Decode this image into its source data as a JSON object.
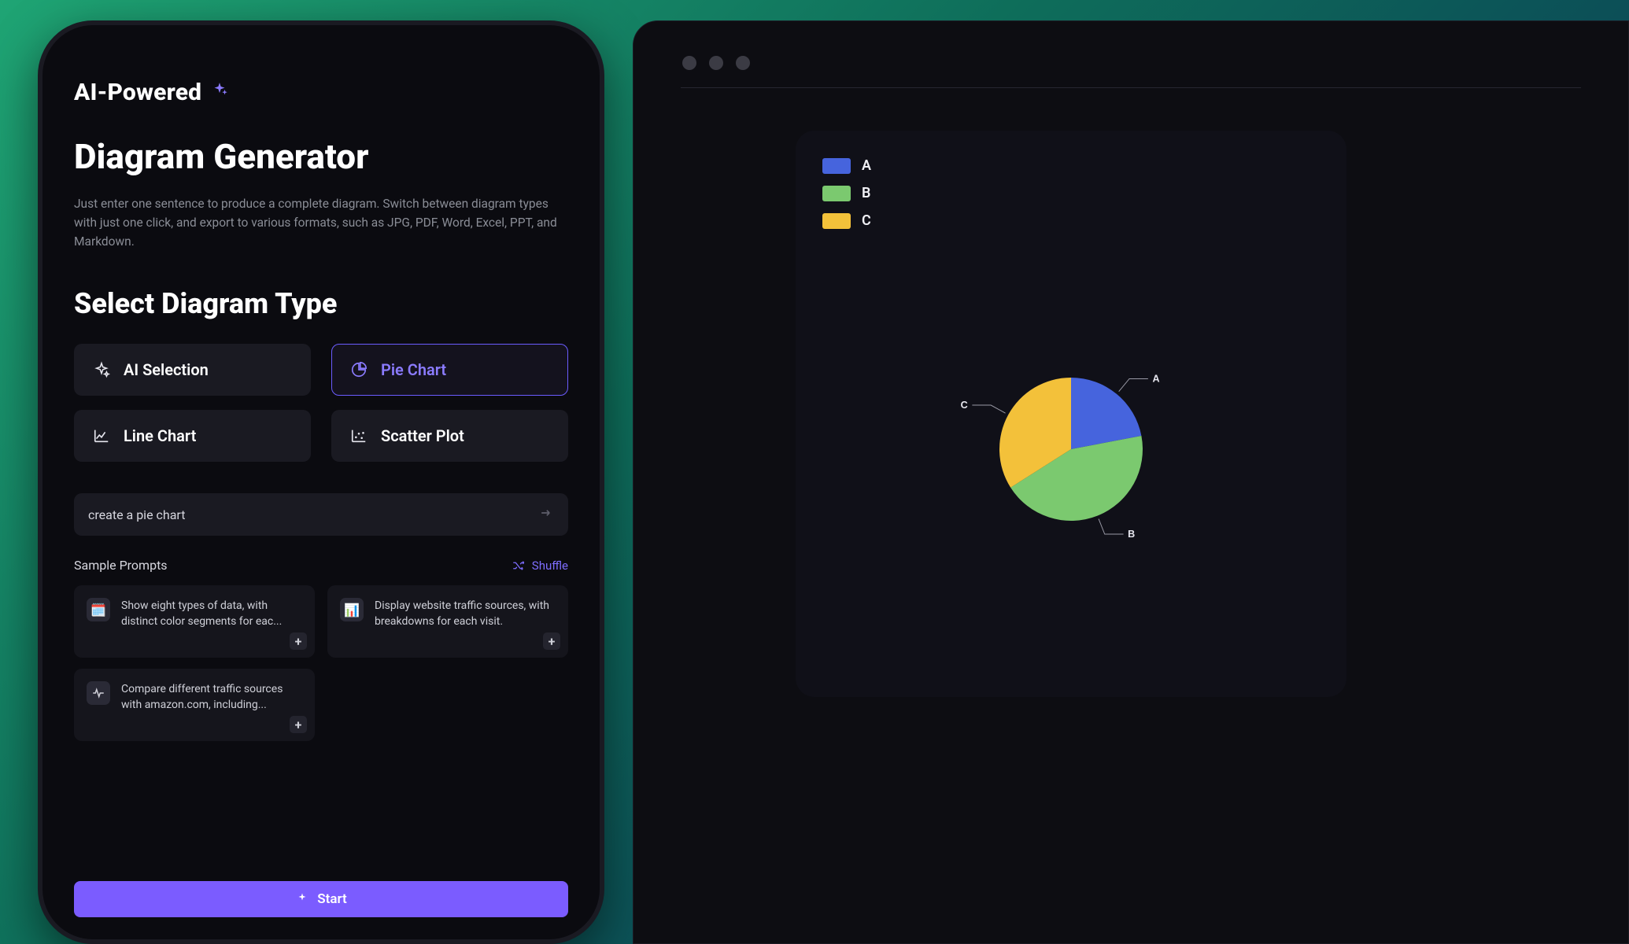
{
  "left": {
    "brand": "AI-Powered",
    "headline": "Diagram Generator",
    "subtext": "Just enter one sentence to produce a complete diagram. Switch between diagram types with just one click, and export to various formats, such as JPG, PDF, Word, Excel, PPT, and Markdown.",
    "section": "Select Diagram Type",
    "types": {
      "ai": "AI Selection",
      "pie": "Pie Chart",
      "line": "Line Chart",
      "scatter": "Scatter Plot"
    },
    "prompt_value": "create a pie chart",
    "samples_label": "Sample Prompts",
    "shuffle_label": "Shuffle",
    "samples": {
      "s1": "Show eight types of data, with distinct color segments for eac...",
      "s2": "Display website traffic sources, with breakdowns for each visit.",
      "s3": "Compare different traffic sources with amazon.com, including..."
    },
    "start_label": "Start"
  },
  "chart_data": {
    "type": "pie",
    "series": [
      {
        "name": "A",
        "value": 22,
        "color": "#4664dd"
      },
      {
        "name": "B",
        "value": 44,
        "color": "#7bc96f"
      },
      {
        "name": "C",
        "value": 34,
        "color": "#f3c13a"
      }
    ]
  }
}
